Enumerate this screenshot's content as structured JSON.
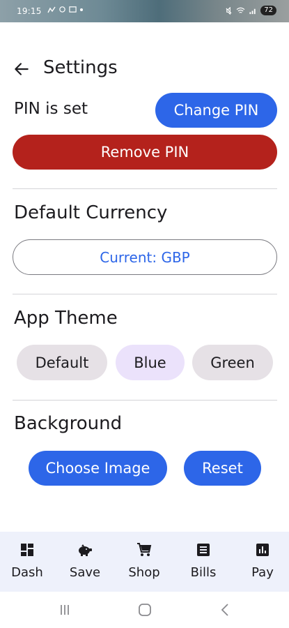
{
  "status_bar": {
    "time": "19:15",
    "left_icons": [
      "signal-icon",
      "sync-icon",
      "cast-icon",
      "dot-icon"
    ],
    "right_icons": [
      "mute-icon",
      "wifi-icon",
      "signal-bars-icon"
    ],
    "battery": "72"
  },
  "header": {
    "title": "Settings",
    "back_icon": "back-arrow-icon"
  },
  "pin": {
    "status": "PIN is set",
    "change_label": "Change PIN",
    "remove_label": "Remove PIN"
  },
  "currency": {
    "title": "Default Currency",
    "current_label": "Current: GBP"
  },
  "theme": {
    "title": "App Theme",
    "options": [
      {
        "label": "Default",
        "selected": false
      },
      {
        "label": "Blue",
        "selected": true
      },
      {
        "label": "Green",
        "selected": false
      }
    ]
  },
  "background": {
    "title": "Background",
    "choose_label": "Choose Image",
    "reset_label": "Reset"
  },
  "bottom_nav": [
    {
      "label": "Dash",
      "icon": "dashboard-icon"
    },
    {
      "label": "Save",
      "icon": "piggy-bank-icon"
    },
    {
      "label": "Shop",
      "icon": "cart-icon"
    },
    {
      "label": "Bills",
      "icon": "receipt-icon"
    },
    {
      "label": "Pay",
      "icon": "chart-icon"
    }
  ],
  "colors": {
    "primary": "#2d66e8",
    "danger": "#b4221c",
    "chip": "#e6e1e6",
    "chip_selected": "#ebe2fb",
    "nav_bg": "#eef1fb"
  }
}
